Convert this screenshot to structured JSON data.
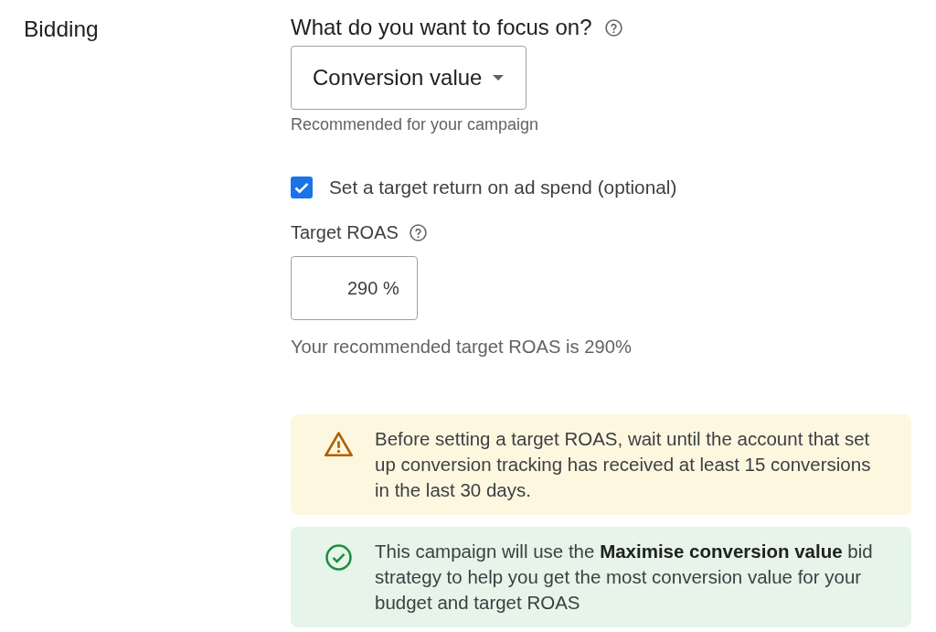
{
  "section_label": "Bidding",
  "focus": {
    "label": "What do you want to focus on?",
    "dropdown": {
      "value": "Conversion value"
    },
    "hint": "Recommended for your campaign"
  },
  "target_checkbox": {
    "label": "Set a target return on ad spend (optional)",
    "checked": true
  },
  "target_roas": {
    "label": "Target ROAS",
    "value": "290",
    "unit": "%",
    "recommendation": "Your recommended target ROAS is 290%"
  },
  "notices": [
    {
      "kind": "warning",
      "text": "Before setting a target ROAS, wait until the account that set up conversion tracking has received at least 15 conversions in the last 30 days."
    },
    {
      "kind": "success",
      "text": "This campaign will use the **Maximise conversion value** bid strategy to help you get the most conversion value for your budget and target ROAS"
    }
  ]
}
